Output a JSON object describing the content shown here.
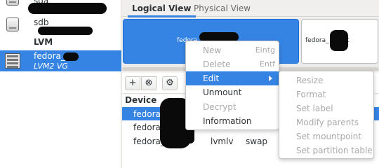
{
  "sidebar": {
    "items": [
      {
        "name": "sda"
      },
      {
        "name": "sdb"
      },
      {
        "name": "LVM"
      },
      {
        "name": "fedora_",
        "subtitle": "LVM2 VG"
      }
    ]
  },
  "tabs": [
    {
      "label": "Logical View",
      "active": true
    },
    {
      "label": "Physical View",
      "active": false
    }
  ],
  "map": {
    "blocks": [
      {
        "label": "fedora",
        "selected": true
      },
      {
        "label": "fedora_       s-root",
        "selected": false
      }
    ]
  },
  "toolbar": {
    "add_icon": "plus-icon",
    "remove_icon": "remove-circle-icon",
    "settings_icon": "gears-icon",
    "add_glyph": "+",
    "remove_glyph": "⊗",
    "settings_glyph": "⚙"
  },
  "table": {
    "header": "Device",
    "rows": [
      {
        "device": "fedora_",
        "col2": "",
        "col3": ""
      },
      {
        "device": "fedora_",
        "col2": "",
        "col3": ""
      },
      {
        "device": "fedora_",
        "col2": "lvmlv",
        "col3": "swap"
      }
    ]
  },
  "context_menu": {
    "items": [
      {
        "label": "New",
        "accel": "Eintg",
        "disabled": true
      },
      {
        "label": "Delete",
        "accel": "Entf",
        "disabled": true
      },
      {
        "label": "Edit",
        "submenu": true,
        "active": true
      },
      {
        "label": "Unmount",
        "disabled": false
      },
      {
        "label": "Decrypt",
        "disabled": true
      },
      {
        "label": "Information",
        "disabled": false
      }
    ]
  },
  "edit_submenu": {
    "items": [
      {
        "label": "Resize"
      },
      {
        "label": "Format"
      },
      {
        "label": "Set label"
      },
      {
        "label": "Modify parents"
      },
      {
        "label": "Set mountpoint"
      },
      {
        "label": "Set partition table"
      }
    ]
  },
  "colors": {
    "accent": "#3584e4",
    "disabled_text": "#a9a9a9"
  }
}
